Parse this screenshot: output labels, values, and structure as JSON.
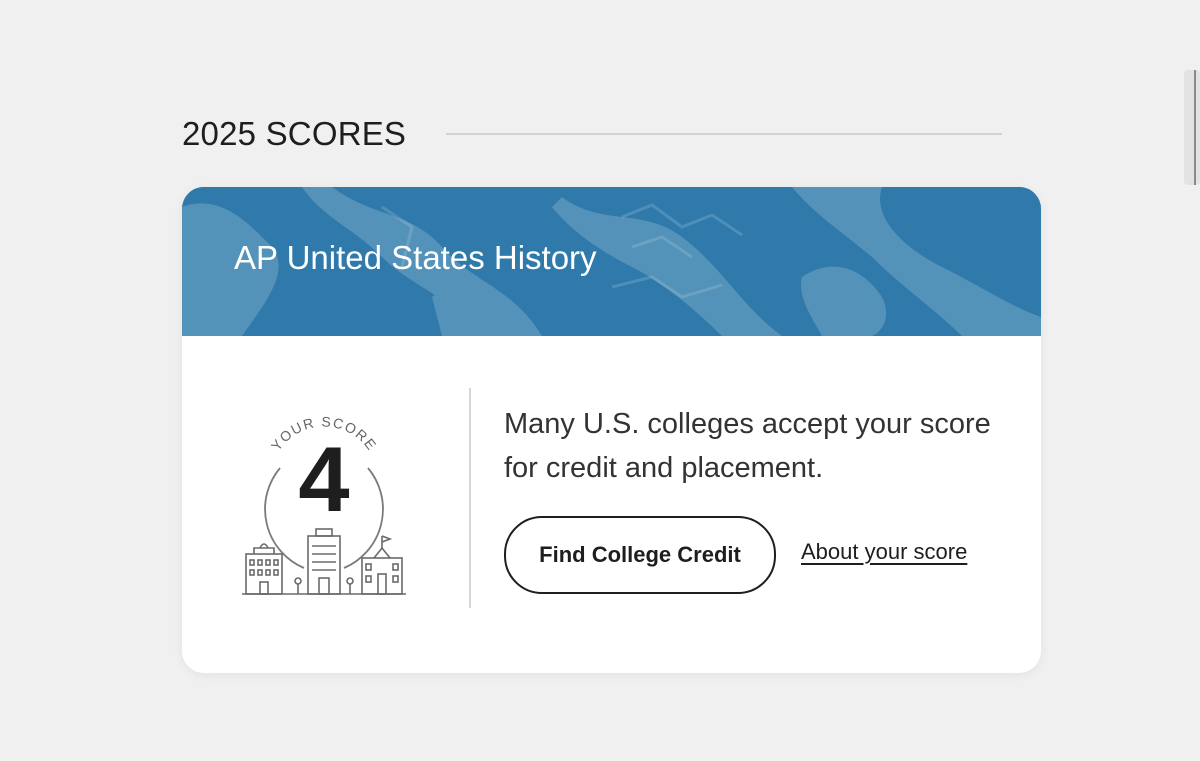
{
  "section": {
    "title": "2025 SCORES"
  },
  "card": {
    "course_title": "AP United States History",
    "score_label": "YOUR SCORE",
    "score_value": "4",
    "message": "Many U.S. colleges accept your score for credit and placement.",
    "primary_button_label": "Find College Credit",
    "secondary_link_label": "About your score"
  },
  "colors": {
    "background": "#f0f0f0",
    "banner_blue": "#2f7aab",
    "text_dark": "#1e1e1e",
    "card_white": "#ffffff"
  },
  "icons": {
    "score_emblem": "college-buildings-icon",
    "banner_image": "historical-document-image"
  }
}
